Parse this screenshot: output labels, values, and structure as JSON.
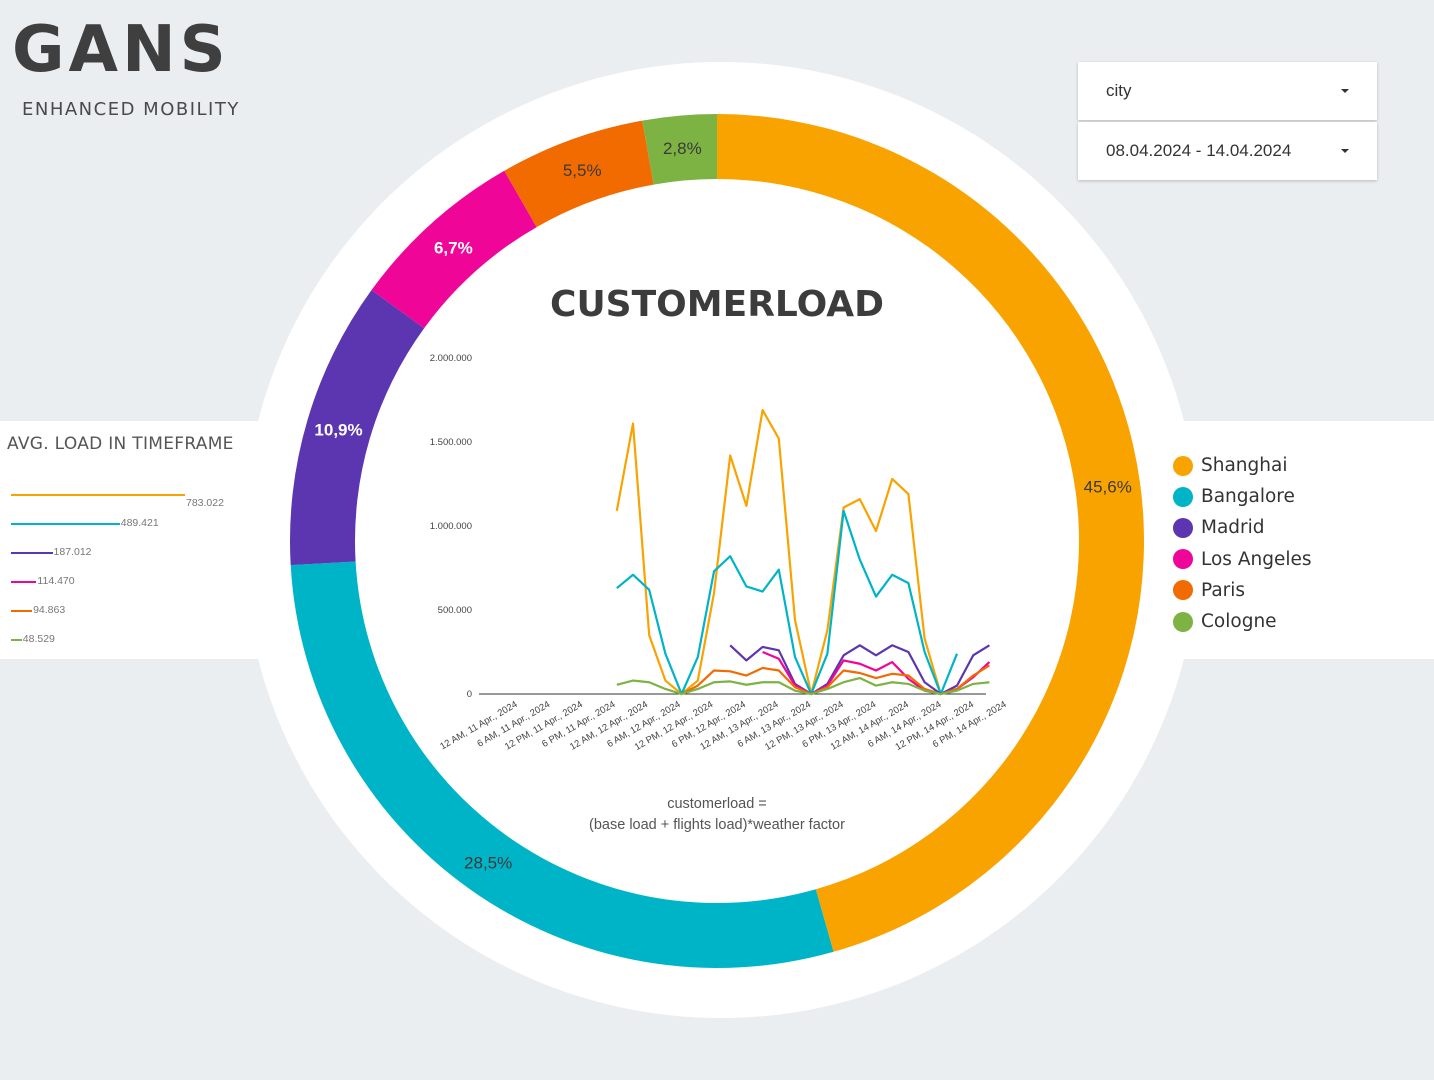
{
  "header": {
    "logo_title": "GANS",
    "logo_subtitle": "ENHANCED MOBILITY"
  },
  "filters": {
    "city_label": "city",
    "date_range": "08.04.2024 - 14.04.2024",
    "caret_icon": "caret-down-icon"
  },
  "avg_panel": {
    "title": "AVG. LOAD IN TIMEFRAME",
    "items": [
      {
        "value_label": "783.022",
        "value": 783022,
        "color": "#f9a300"
      },
      {
        "value_label": "489.421",
        "value": 489421,
        "color": "#00b4c8"
      },
      {
        "value_label": "187.012",
        "value": 187012,
        "color": "#5c35b0"
      },
      {
        "value_label": "114.470",
        "value": 114470,
        "color": "#ef0597"
      },
      {
        "value_label": "94.863",
        "value": 94863,
        "color": "#f26b00"
      },
      {
        "value_label": "48.529",
        "value": 48529,
        "color": "#7cb342"
      }
    ]
  },
  "legend": [
    {
      "name": "Shanghai",
      "color": "#f9a300"
    },
    {
      "name": "Bangalore",
      "color": "#00b4c8"
    },
    {
      "name": "Madrid",
      "color": "#5c35b0"
    },
    {
      "name": "Los Angeles",
      "color": "#ef0597"
    },
    {
      "name": "Paris",
      "color": "#f26b00"
    },
    {
      "name": "Cologne",
      "color": "#7cb342"
    }
  ],
  "chart_title": "CUSTOMERLOAD",
  "formula": {
    "line1": "customerload =",
    "line2": "(base load + flights load)*weather factor"
  },
  "chart_data": [
    {
      "type": "pie",
      "variant": "donut",
      "categories": [
        "Shanghai",
        "Bangalore",
        "Madrid",
        "Los Angeles",
        "Paris",
        "Cologne"
      ],
      "values": [
        45.6,
        28.5,
        10.9,
        6.7,
        5.5,
        2.8
      ],
      "labels": [
        "45,6%",
        "28,5%",
        "10,9%",
        "6,7%",
        "5,5%",
        "2,8%"
      ],
      "colors": [
        "#f9a300",
        "#00b4c8",
        "#5c35b0",
        "#ef0597",
        "#f26b00",
        "#7cb342"
      ]
    },
    {
      "type": "line",
      "title": "CUSTOMERLOAD",
      "ylim": [
        0,
        2000000
      ],
      "y_ticks": [
        0,
        500000,
        1000000,
        1500000,
        2000000
      ],
      "y_tick_labels": [
        "0",
        "500.000",
        "1.000.000",
        "1.500.000",
        "2.000.000"
      ],
      "x_tick_labels": [
        "12 AM, 11 Apr., 2024",
        "6 AM, 11 Apr., 2024",
        "12 PM, 11 Apr., 2024",
        "6 PM, 11 Apr., 2024",
        "12 AM, 12 Apr., 2024",
        "6 AM, 12 Apr., 2024",
        "12 PM, 12 Apr., 2024",
        "6 PM, 12 Apr., 2024",
        "12 AM, 13 Apr., 2024",
        "6 AM, 13 Apr., 2024",
        "12 PM, 13 Apr., 2024",
        "6 PM, 13 Apr., 2024",
        "12 AM, 14 Apr., 2024",
        "6 AM, 14 Apr., 2024",
        "12 PM, 14 Apr., 2024",
        "6 PM, 14 Apr., 2024"
      ],
      "x_step_hours": 3,
      "series": [
        {
          "name": "Shanghai",
          "color": "#f9a300",
          "values": [
            null,
            null,
            null,
            null,
            1090000,
            1610000,
            350000,
            80000,
            0,
            80000,
            600000,
            1420000,
            1120000,
            1690000,
            1520000,
            440000,
            0,
            380000,
            1110000,
            1160000,
            970000,
            1280000,
            1190000,
            330000,
            0,
            null,
            null,
            null,
            null,
            null,
            null,
            null
          ]
        },
        {
          "name": "Bangalore",
          "color": "#00b4c8",
          "values": [
            null,
            null,
            null,
            null,
            630000,
            710000,
            620000,
            240000,
            0,
            220000,
            730000,
            820000,
            640000,
            610000,
            740000,
            220000,
            0,
            240000,
            1090000,
            800000,
            580000,
            710000,
            660000,
            250000,
            0,
            240000,
            null,
            null,
            null,
            null,
            null,
            null
          ]
        },
        {
          "name": "Madrid",
          "color": "#5c35b0",
          "values": [
            null,
            null,
            null,
            null,
            null,
            null,
            null,
            null,
            null,
            null,
            null,
            290000,
            200000,
            280000,
            260000,
            60000,
            0,
            60000,
            230000,
            290000,
            230000,
            290000,
            250000,
            70000,
            0,
            50000,
            230000,
            290000,
            null,
            null,
            null,
            null
          ]
        },
        {
          "name": "Los Angeles",
          "color": "#ef0597",
          "values": [
            null,
            null,
            null,
            null,
            null,
            null,
            null,
            null,
            null,
            null,
            null,
            null,
            null,
            250000,
            210000,
            50000,
            0,
            50000,
            200000,
            180000,
            140000,
            190000,
            90000,
            20000,
            0,
            30000,
            100000,
            190000,
            null,
            null,
            null,
            null
          ]
        },
        {
          "name": "Paris",
          "color": "#f26b00",
          "values": [
            null,
            null,
            null,
            null,
            null,
            null,
            null,
            null,
            0,
            50000,
            140000,
            135000,
            110000,
            155000,
            140000,
            40000,
            0,
            40000,
            140000,
            125000,
            95000,
            120000,
            110000,
            30000,
            0,
            30000,
            110000,
            170000,
            null,
            null,
            null,
            null
          ]
        },
        {
          "name": "Cologne",
          "color": "#7cb342",
          "values": [
            null,
            null,
            null,
            null,
            55000,
            80000,
            70000,
            30000,
            0,
            30000,
            70000,
            75000,
            55000,
            70000,
            70000,
            20000,
            0,
            30000,
            70000,
            95000,
            50000,
            70000,
            60000,
            20000,
            0,
            20000,
            60000,
            70000,
            null,
            null,
            null,
            null
          ]
        }
      ]
    }
  ]
}
